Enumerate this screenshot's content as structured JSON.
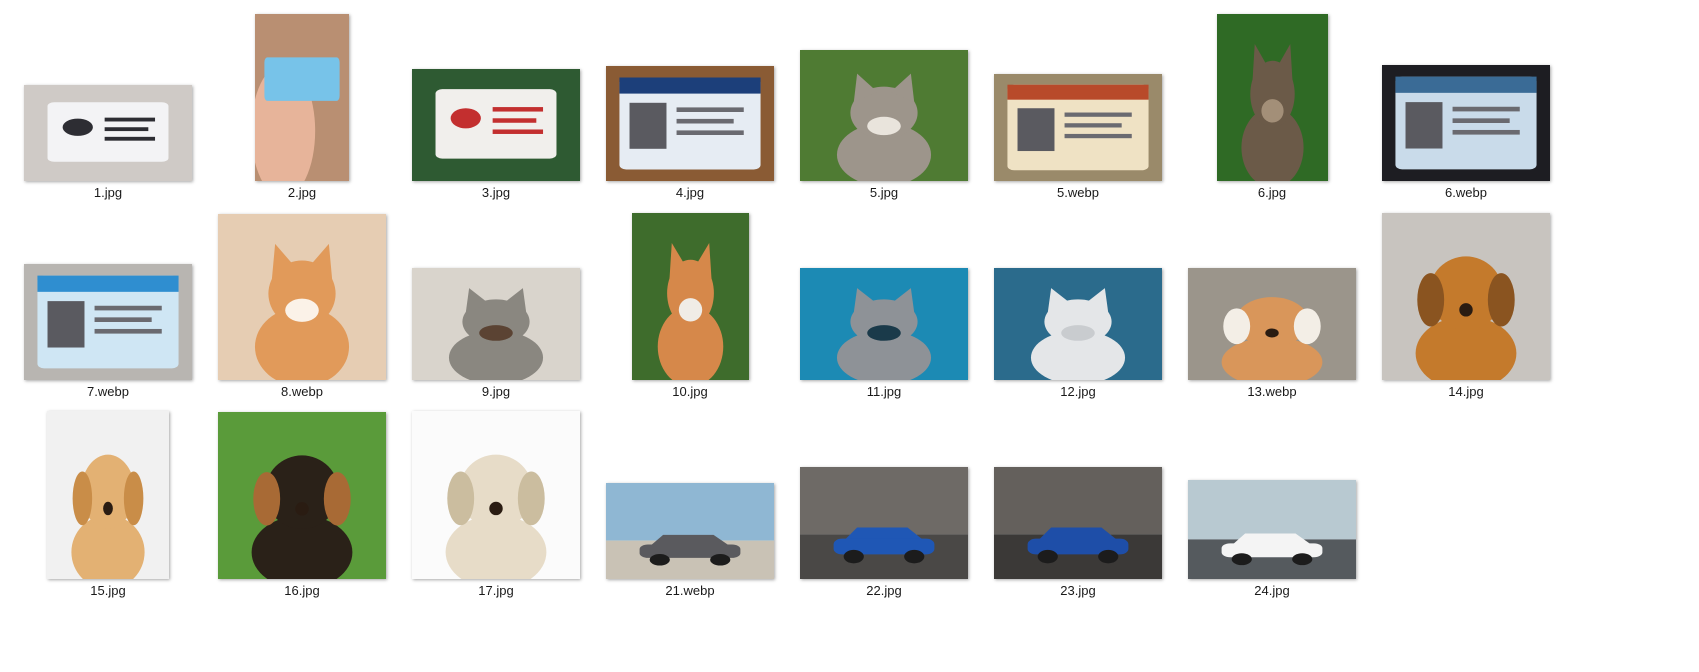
{
  "files": [
    {
      "name": "1.jpg",
      "icon": "id-card-photo-icon",
      "colors": [
        "#cfcac6",
        "#f3f3f5",
        "#2d2d33"
      ]
    },
    {
      "name": "2.jpg",
      "icon": "hand-card-photo-icon",
      "colors": [
        "#b98f72",
        "#77c3e9",
        "#e7b49a"
      ]
    },
    {
      "name": "3.jpg",
      "icon": "id-card-photo-icon",
      "colors": [
        "#2e5a32",
        "#f1efec",
        "#c32f2f"
      ]
    },
    {
      "name": "4.jpg",
      "icon": "license-photo-icon",
      "colors": [
        "#8a5b34",
        "#e6ecf3",
        "#1c3f7a"
      ]
    },
    {
      "name": "5.jpg",
      "icon": "cat-photo-icon",
      "colors": [
        "#4f7b33",
        "#9d958b",
        "#e9e4dc"
      ]
    },
    {
      "name": "5.webp",
      "icon": "license-photo-icon",
      "colors": [
        "#9a8a6a",
        "#efe2c4",
        "#b84a2a"
      ]
    },
    {
      "name": "6.jpg",
      "icon": "cat-photo-icon",
      "colors": [
        "#2f6a25",
        "#6b5a48",
        "#a38f78"
      ]
    },
    {
      "name": "6.webp",
      "icon": "license-photo-icon",
      "colors": [
        "#1d1d22",
        "#c9dbea",
        "#3a6b96"
      ]
    },
    {
      "name": "7.webp",
      "icon": "license-photo-icon",
      "colors": [
        "#b8b5b1",
        "#cfe6f4",
        "#2f8ed0"
      ]
    },
    {
      "name": "8.webp",
      "icon": "cat-photo-icon",
      "colors": [
        "#e6cdb3",
        "#e19a5a",
        "#fbf2e8"
      ]
    },
    {
      "name": "9.jpg",
      "icon": "cat-photo-icon",
      "colors": [
        "#d9d4cc",
        "#8a8780",
        "#5b4333"
      ]
    },
    {
      "name": "10.jpg",
      "icon": "cat-photo-icon",
      "colors": [
        "#3e6c2c",
        "#d6884a",
        "#f0ece6"
      ]
    },
    {
      "name": "11.jpg",
      "icon": "cat-photo-icon",
      "colors": [
        "#1c8ab4",
        "#8e9297",
        "#1a3a4a"
      ]
    },
    {
      "name": "12.jpg",
      "icon": "cat-photo-icon",
      "colors": [
        "#2b6b8c",
        "#e4e6e8",
        "#c9cccf"
      ]
    },
    {
      "name": "13.webp",
      "icon": "dog-photo-icon",
      "colors": [
        "#9b958b",
        "#d9965a",
        "#f3eee6"
      ]
    },
    {
      "name": "14.jpg",
      "icon": "dog-photo-icon",
      "colors": [
        "#c8c4bf",
        "#c47a2c",
        "#8a5420"
      ]
    },
    {
      "name": "15.jpg",
      "icon": "dog-photo-icon",
      "colors": [
        "#f1f1f1",
        "#e3b173",
        "#c98d48"
      ]
    },
    {
      "name": "16.jpg",
      "icon": "dog-photo-icon",
      "colors": [
        "#5a9b3a",
        "#2a2118",
        "#a86a35"
      ]
    },
    {
      "name": "17.jpg",
      "icon": "dog-photo-icon",
      "colors": [
        "#fbfbfb",
        "#e7dcc8",
        "#cbbd9f"
      ]
    },
    {
      "name": "21.webp",
      "icon": "car-photo-icon",
      "colors": [
        "#8fb7d3",
        "#5a5a5e",
        "#c9c2b5"
      ]
    },
    {
      "name": "22.jpg",
      "icon": "car-photo-icon",
      "colors": [
        "#6e6a66",
        "#1f57b5",
        "#4a4846"
      ]
    },
    {
      "name": "23.jpg",
      "icon": "car-photo-icon",
      "colors": [
        "#64605c",
        "#1e4ea8",
        "#3b3937"
      ]
    },
    {
      "name": "24.jpg",
      "icon": "car-photo-icon",
      "colors": [
        "#b8c9d1",
        "#f4f4f4",
        "#555a5e"
      ]
    }
  ]
}
